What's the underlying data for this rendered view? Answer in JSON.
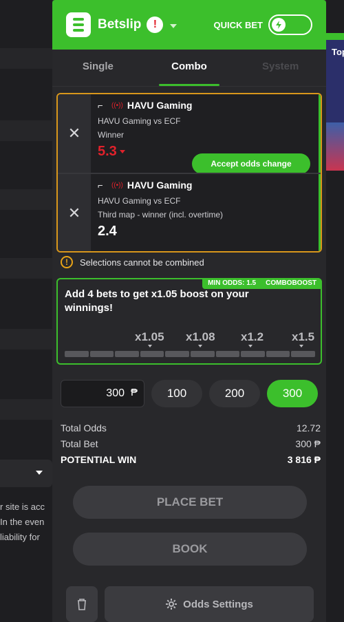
{
  "header": {
    "title": "Betslip",
    "alert_glyph": "!",
    "quick_bet_label": "QUICK BET"
  },
  "tabs": [
    {
      "label": "Single"
    },
    {
      "label": "Combo"
    },
    {
      "label": "System"
    }
  ],
  "selections": [
    {
      "team": "HAVU Gaming",
      "match": "HAVU Gaming vs ECF",
      "market": "Winner",
      "odds": "5.3",
      "accept_label": "Accept odds change"
    },
    {
      "team": "HAVU Gaming",
      "match": "HAVU Gaming vs ECF",
      "market": "Third map - winner (incl. overtime)",
      "odds": "2.4"
    }
  ],
  "warning": "Selections cannot be combined",
  "boost": {
    "min_odds": "MIN ODDS: 1.5",
    "tag": "COMBOBOOST",
    "text": "Add 4 bets to get x1.05 boost on your winnings!",
    "multipliers": [
      "x1.05",
      "x1.08",
      "x1.2",
      "x1.5"
    ]
  },
  "stake": {
    "value": "300",
    "currency": "₱",
    "quick_amounts": [
      "100",
      "200",
      "300"
    ]
  },
  "summary": {
    "total_odds_label": "Total Odds",
    "total_odds": "12.72",
    "total_bet_label": "Total Bet",
    "total_bet": "300 ₱",
    "potential_win_label": "POTENTIAL WIN",
    "potential_win": "3 816 ₱"
  },
  "actions": {
    "place_bet": "PLACE BET",
    "book": "BOOK",
    "odds_settings": "Odds Settings"
  },
  "background": {
    "text_lines": [
      "r site is acc",
      "In the even",
      "liability for"
    ],
    "banner_text": "Top"
  },
  "colors": {
    "brand_green": "#3cbf2c",
    "warning_orange": "#d9971b",
    "odds_down_red": "#e2212b"
  }
}
